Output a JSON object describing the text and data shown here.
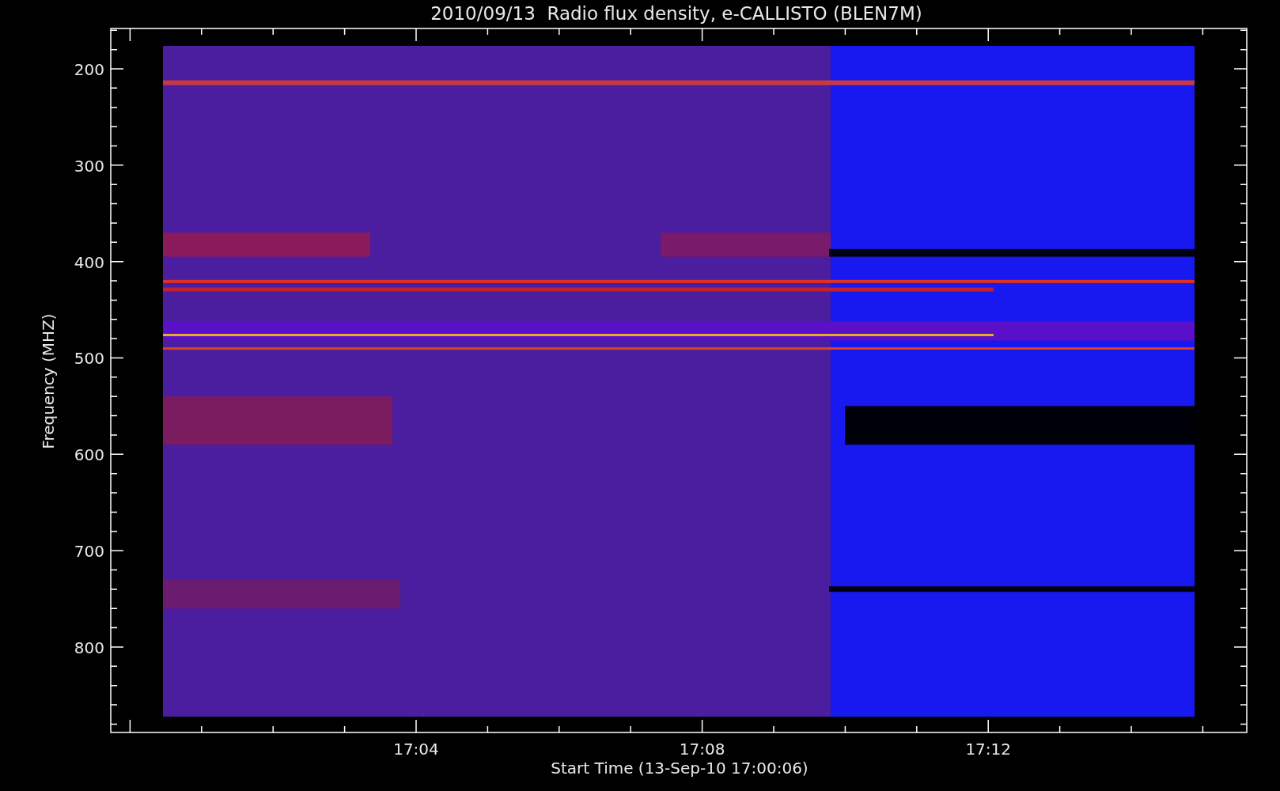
{
  "title": "2010/09/13  Radio flux density, e-CALLISTO (BLEN7M)",
  "y_axis": {
    "label": "Frequency (MHZ)",
    "ticks": [
      "200",
      "300",
      "400",
      "500",
      "600",
      "700",
      "800"
    ]
  },
  "x_axis": {
    "label": "Start Time (13-Sep-10 17:00:06)",
    "ticks": [
      "17:04",
      "17:08",
      "17:12"
    ]
  }
}
